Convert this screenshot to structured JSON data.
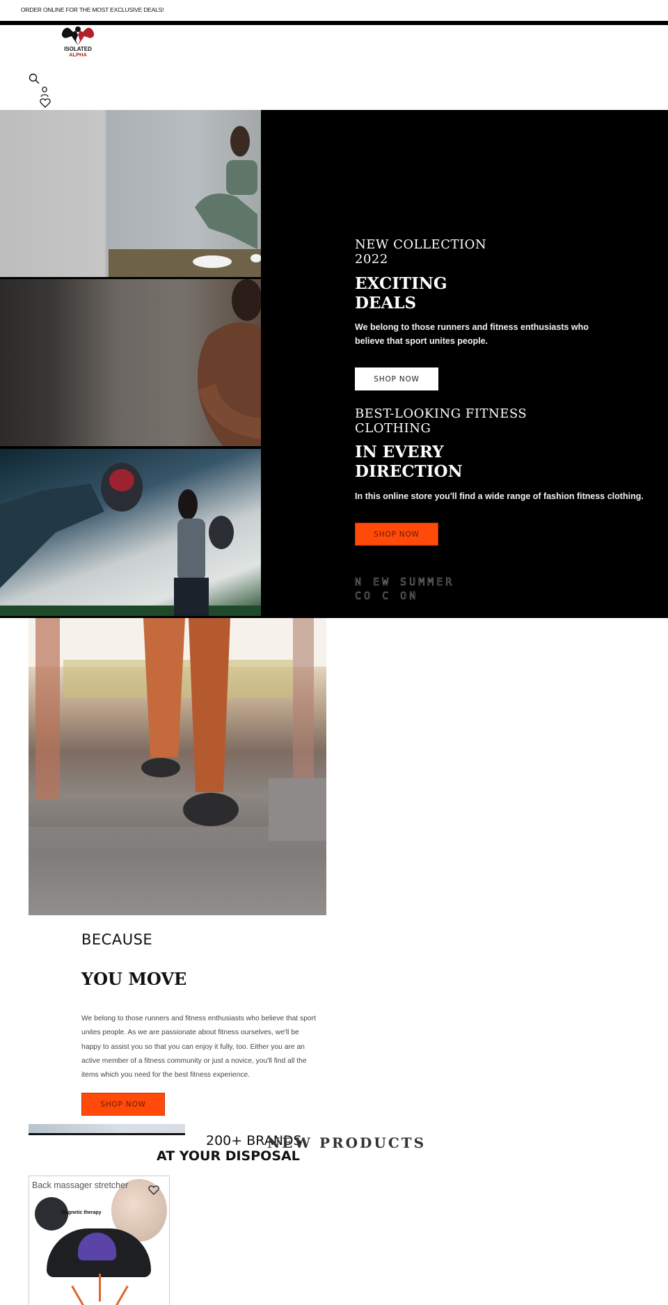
{
  "announcement": {
    "text": "ORDER ONLINE FOR THE MOST EXCLUSIVE DEALS!"
  },
  "header": {
    "logo": {
      "line1": "ISOLATED",
      "line2": "ALPHA"
    },
    "icons": [
      "search-icon",
      "account-icon",
      "wishlist-heart-icon"
    ],
    "colors": {
      "logo_red": "#b3202a",
      "bar": "#000000"
    }
  },
  "hero": {
    "images": [
      "woman-squatting-fitness-photo",
      "bodybuilder-flexing-photo",
      "boxing-training-photo"
    ],
    "slides": [
      {
        "kicker": "NEW COLLECTION 2022",
        "kicker_line1": "NEW COLLECTION",
        "kicker_line2": "2022",
        "headline_line1": "EXCITING",
        "headline_line2": "DEALS",
        "subtext_line1": "We belong to those runners and fitness enthusiasts who",
        "subtext_line2": "believe that sport unites people.",
        "button": "SHOP NOW"
      },
      {
        "kicker_line1": "BEST-LOOKING FITNESS",
        "kicker_line2": "CLOTHING",
        "headline_line1": "IN EVERY",
        "headline_line2": "DIRECTION",
        "subtext": "In this online store you'll find a wide range of fashion fitness clothing.",
        "button": "SHOP NOW"
      },
      {
        "kicker_line1": "N EW SUMMER",
        "kicker_line2": "CO  C  ON"
      }
    ],
    "colors": {
      "background": "#000000",
      "accent": "#ff4a0a"
    }
  },
  "story": {
    "image": "treadmill-running-photo",
    "eyebrow": "BECAUSE",
    "title": "YOU MOVE",
    "body": "We belong to those runners and fitness enthusiasts who believe that sport unites people. As we are passionate about fitness ourselves, we'll be happy to assist you so that you can enjoy it fully, too. Either you are an active member of a fitness community or just a novice, you'll find all the items which you need for the best fitness experience.",
    "button": "SHOP NOW"
  },
  "brands": {
    "line1": "200+ BRANDS",
    "line2": "AT YOUR DISPOSAL"
  },
  "new_products": {
    "title": "NEW PRODUCTS",
    "items": [
      {
        "image_title": "Back massager stretcher",
        "image_caption": "Magnetic therapy",
        "wishlist": "wishlist-heart-icon"
      }
    ]
  }
}
